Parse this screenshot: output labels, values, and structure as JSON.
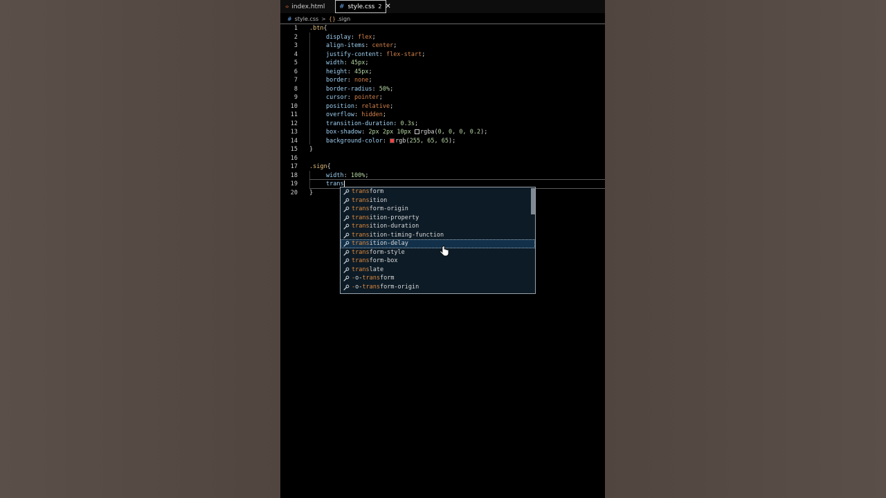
{
  "tabs": [
    {
      "label": "index.html",
      "icon": "html-icon",
      "active": false
    },
    {
      "label": "style.css",
      "icon": "css-icon",
      "active": true,
      "problems": "2",
      "close": "✕"
    }
  ],
  "breadcrumb": {
    "file": "style.css",
    "separator": ">",
    "symbol": ".sign"
  },
  "code": {
    "lines": [
      {
        "n": "1",
        "t": ".btn{"
      },
      {
        "n": "2",
        "t": "    display: flex;"
      },
      {
        "n": "3",
        "t": "    align-items: center;"
      },
      {
        "n": "4",
        "t": "    justify-content: flex-start;"
      },
      {
        "n": "5",
        "t": "    width: 45px;"
      },
      {
        "n": "6",
        "t": "    height: 45px;"
      },
      {
        "n": "7",
        "t": "    border: none;"
      },
      {
        "n": "8",
        "t": "    border-radius: 50%;"
      },
      {
        "n": "9",
        "t": "    cursor: pointer;"
      },
      {
        "n": "10",
        "t": "    position: relative;"
      },
      {
        "n": "11",
        "t": "    overflow: hidden;"
      },
      {
        "n": "12",
        "t": "    transition-duration: 0.3s;"
      },
      {
        "n": "13",
        "t": "    box-shadow: 2px 2px 10px rgba(0, 0, 0, 0.2);"
      },
      {
        "n": "14",
        "t": "    background-color: rgb(255, 65, 65);"
      },
      {
        "n": "15",
        "t": "}"
      },
      {
        "n": "16",
        "t": ""
      },
      {
        "n": "17",
        "t": ".sign{"
      },
      {
        "n": "18",
        "t": "    width: 100%;"
      },
      {
        "n": "19",
        "t": "    trans"
      },
      {
        "n": "20",
        "t": "}"
      }
    ]
  },
  "suggest": {
    "typed": "trans",
    "items": [
      "transform",
      "transition",
      "transform-origin",
      "transition-property",
      "transition-duration",
      "transition-timing-function",
      "transition-delay",
      "transform-style",
      "transform-box",
      "translate",
      "-o-transform",
      "-o-transform-origin"
    ],
    "selected_index": 6
  },
  "colors": {
    "swatch_shadow": "#000000",
    "swatch_background": "#ff4141"
  }
}
